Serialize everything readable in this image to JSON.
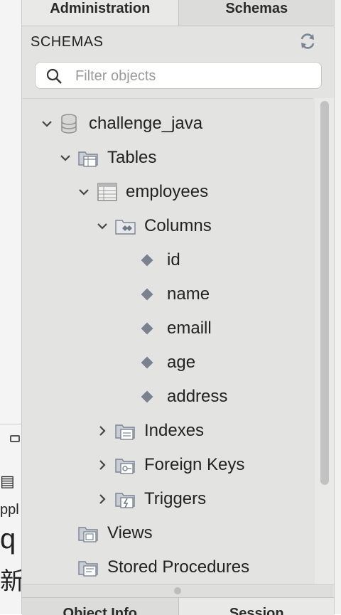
{
  "top_tabs": [
    "Administration",
    "Schemas"
  ],
  "schemas_header": "SCHEMAS",
  "filter": {
    "placeholder": "Filter objects",
    "value": ""
  },
  "tree": {
    "schema": "challenge_java",
    "tables": "Tables",
    "table": "employees",
    "columns": "Columns",
    "column_items": [
      "id",
      "name",
      "emaill",
      "age",
      "address"
    ],
    "indexes": "Indexes",
    "foreign_keys": "Foreign Keys",
    "triggers": "Triggers",
    "views": "Views",
    "stored_procedures": "Stored Procedures"
  },
  "bottom_tabs": [
    "Object Info",
    "Session"
  ],
  "background_fragments": {
    "app": "ppl",
    "big": "q l",
    "cjk": "新"
  },
  "icons": {
    "refresh": "refresh-icon",
    "search": "search-icon",
    "database": "database-icon",
    "folder": "folder-icon",
    "table": "table-icon",
    "column": "column-diamond-icon"
  },
  "colors": {
    "panel": "#e3e3e1",
    "column_diamond": "#7a8290",
    "scroll_thumb": "#c2c2c2"
  }
}
